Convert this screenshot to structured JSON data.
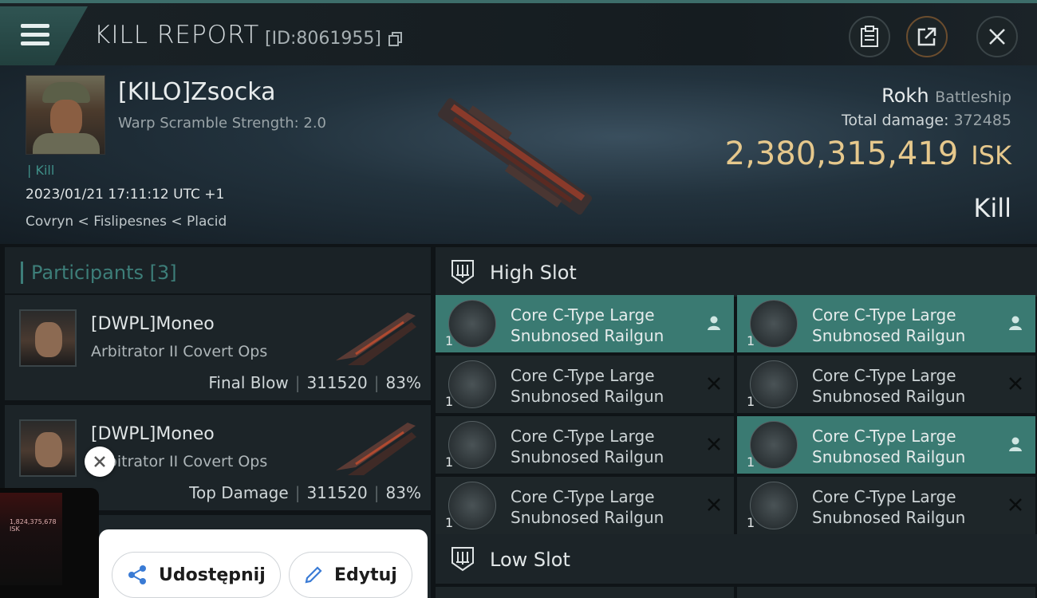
{
  "header": {
    "title": "KILL REPORT",
    "id_text": "[ID:8061955]"
  },
  "victim": {
    "name": "[KILO]Zsocka",
    "subtitle": "Warp Scramble Strength: 2.0",
    "tag": "Kill",
    "datetime": "2023/01/21 17:11:12 UTC +1",
    "location": "Covryn < Fislipesnes < Placid",
    "ship": "Rokh",
    "ship_class": "Battleship",
    "damage_label": "Total damage:",
    "damage_value": "372485",
    "isk_value": "2,380,315,419",
    "isk_unit": "ISK",
    "result": "Kill"
  },
  "participants": {
    "title": "Participants",
    "count": "[3]",
    "items": [
      {
        "name": "[DWPL]Moneo",
        "ship": "Arbitrator II Covert Ops",
        "role": "Final Blow",
        "damage": "311520",
        "percent": "83%"
      },
      {
        "name": "[DWPL]Moneo",
        "ship": "Arbitrator II Covert Ops",
        "role": "Top Damage",
        "damage": "311520",
        "percent": "83%"
      }
    ]
  },
  "slots": {
    "high": {
      "label": "High Slot",
      "modules": [
        {
          "line1": "Core C-Type Large",
          "line2": "Snubnosed Railgun",
          "qty": "1",
          "status": "dropped"
        },
        {
          "line1": "Core C-Type Large",
          "line2": "Snubnosed Railgun",
          "qty": "1",
          "status": "dropped"
        },
        {
          "line1": "Core C-Type Large",
          "line2": "Snubnosed Railgun",
          "qty": "1",
          "status": "destroyed"
        },
        {
          "line1": "Core C-Type Large",
          "line2": "Snubnosed Railgun",
          "qty": "1",
          "status": "destroyed"
        },
        {
          "line1": "Core C-Type Large",
          "line2": "Snubnosed Railgun",
          "qty": "1",
          "status": "destroyed"
        },
        {
          "line1": "Core C-Type Large",
          "line2": "Snubnosed Railgun",
          "qty": "1",
          "status": "dropped"
        },
        {
          "line1": "Core C-Type Large",
          "line2": "Snubnosed Railgun",
          "qty": "1",
          "status": "destroyed"
        },
        {
          "line1": "Core C-Type Large",
          "line2": "Snubnosed Railgun",
          "qty": "1",
          "status": "destroyed"
        }
      ]
    },
    "low": {
      "label": "Low Slot"
    }
  },
  "share_sheet": {
    "share_label": "Udostępnij",
    "edit_label": "Edytuj",
    "thumb_text": "1,824,375,678 ISK"
  },
  "colors": {
    "accent": "#3a7a72",
    "isk": "#e6c88c",
    "participants": "#3d7e79"
  }
}
